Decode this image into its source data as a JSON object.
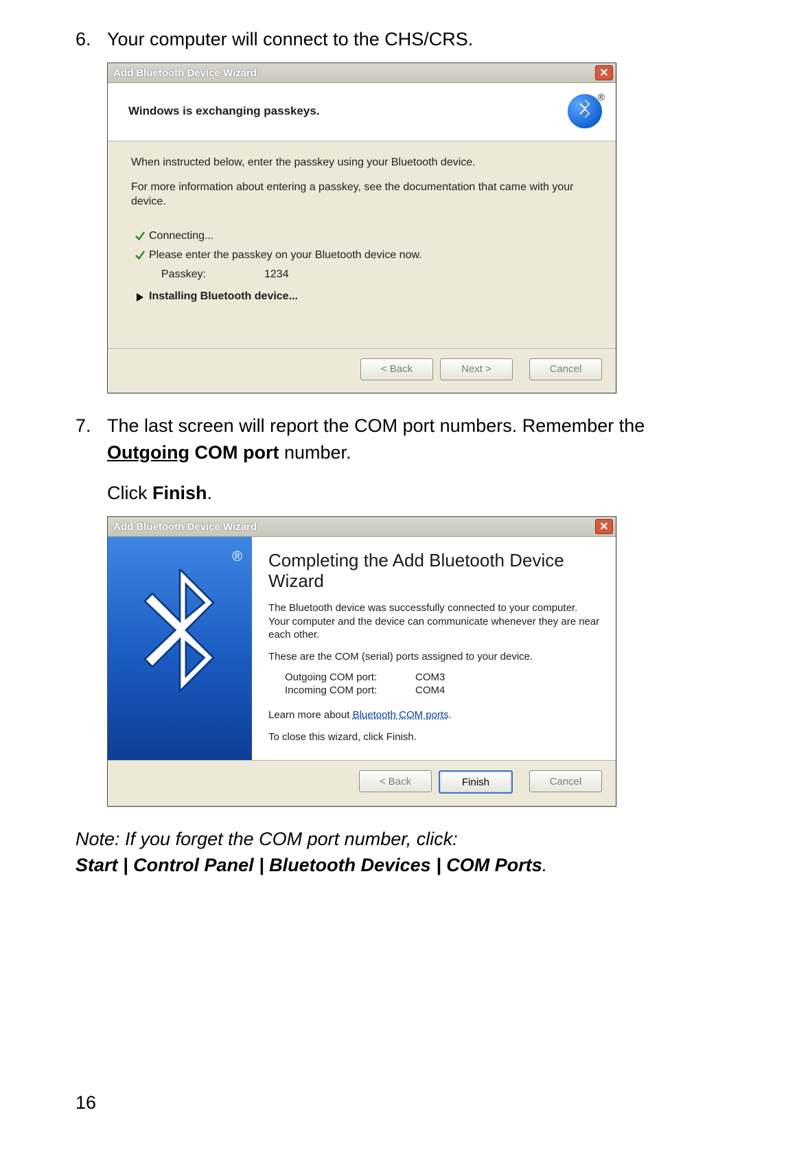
{
  "step6": {
    "num": "6.",
    "text": "Your computer will connect to the CHS/CRS."
  },
  "dialog1": {
    "title": "Add Bluetooth Device Wizard",
    "header": "Windows is exchanging passkeys.",
    "p1": "When instructed below, enter the passkey using your Bluetooth device.",
    "p2": "For more information about entering a passkey, see the documentation that came with your device.",
    "statuses": {
      "connecting": "Connecting...",
      "enter": "Please enter the passkey on your Bluetooth device now.",
      "passkey_label": "Passkey:",
      "passkey_value": "1234",
      "installing": "Installing Bluetooth device..."
    },
    "buttons": {
      "back": "< Back",
      "next": "Next >",
      "cancel": "Cancel"
    }
  },
  "step7": {
    "num": "7.",
    "line1a": "The last screen will report the COM port numbers. Remember the ",
    "line1b": "Outgoing",
    "line1c": " COM port",
    "line1d": " number.",
    "line2a": "Click ",
    "line2b": "Finish",
    "line2c": "."
  },
  "dialog2": {
    "title": "Add Bluetooth Device Wizard",
    "h2": "Completing the Add Bluetooth Device Wizard",
    "p1": "The Bluetooth device was successfully connected to your computer. Your computer and the device can communicate whenever they are near each other.",
    "p2": "These are the COM (serial) ports assigned to your device.",
    "out_label": "Outgoing COM port:",
    "out_val": "COM3",
    "in_label": "Incoming COM port:",
    "in_val": "COM4",
    "learn_a": "Learn more about ",
    "learn_link": "Bluetooth COM ports",
    "learn_b": ".",
    "close": "To close this wizard, click Finish.",
    "buttons": {
      "back": "< Back",
      "finish": "Finish",
      "cancel": "Cancel"
    }
  },
  "note": {
    "l1": "Note: If you forget the COM port number, click:",
    "l2": "Start | Control Panel | Bluetooth Devices | COM Ports",
    "l2tail": "."
  },
  "page_number": "16"
}
